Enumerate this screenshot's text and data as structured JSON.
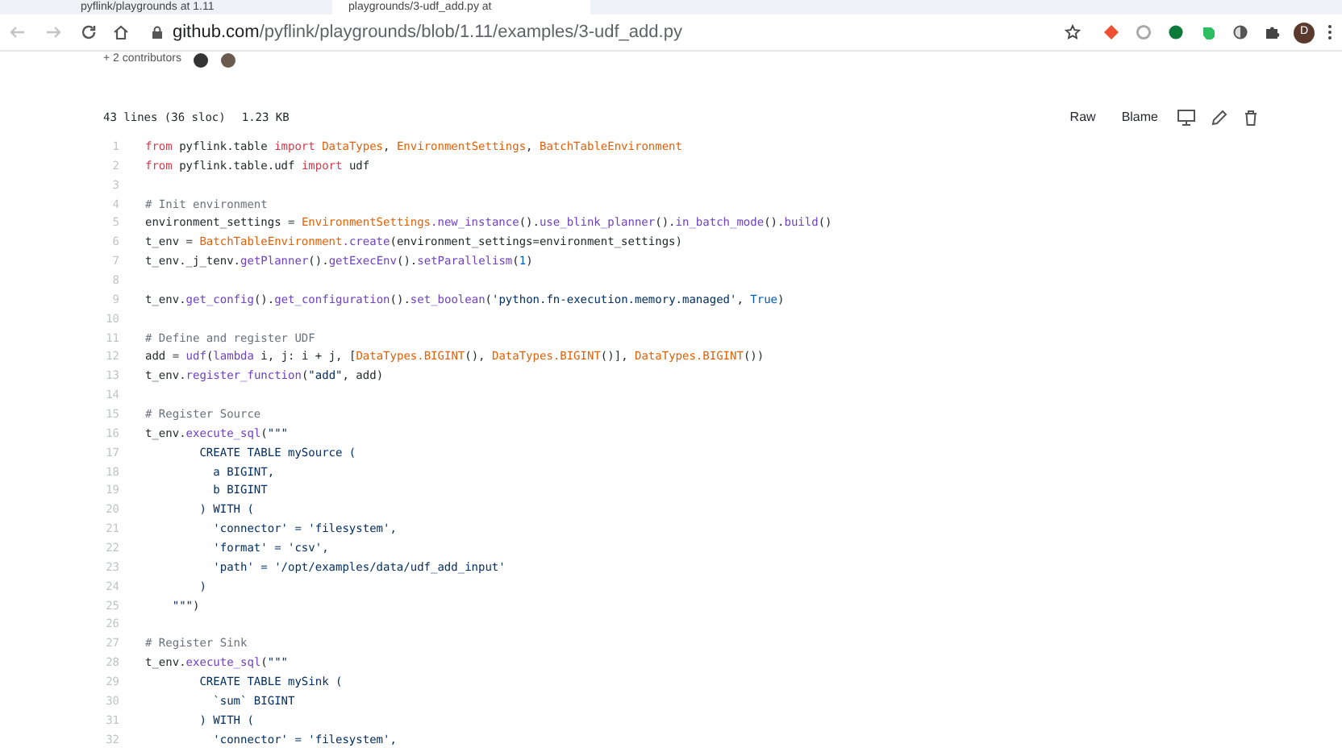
{
  "browser": {
    "tabs": [
      {
        "title": "pyflink/playgrounds at 1.11",
        "selected": false
      },
      {
        "title": "playgrounds/3-udf_add.py at",
        "selected": true
      }
    ],
    "url": {
      "host": "github.com",
      "path": "/pyflink/playgrounds/blob/1.11/examples/3-udf_add.py"
    },
    "avatar_letter": "D"
  },
  "contributors": "+ 2 contributors",
  "file": {
    "info": [
      "43 lines (36 sloc)",
      "1.23 KB"
    ],
    "actions": [
      "Raw",
      "Blame"
    ],
    "lines": [
      {
        "number": "1",
        "tokens": [
          {
            "kind": "kw",
            "text": "from"
          },
          {
            "kind": "plain",
            "text": " pyflink.table "
          },
          {
            "kind": "kw",
            "text": "import"
          },
          {
            "kind": "cls",
            "text": " DataTypes"
          },
          {
            "kind": "plain",
            "text": ", "
          },
          {
            "kind": "cls",
            "text": "EnvironmentSettings"
          },
          {
            "kind": "plain",
            "text": ", "
          },
          {
            "kind": "cls",
            "text": "BatchTableEnvironment"
          }
        ]
      },
      {
        "number": "2",
        "tokens": [
          {
            "kind": "kw",
            "text": "from"
          },
          {
            "kind": "plain",
            "text": " pyflink.table.udf "
          },
          {
            "kind": "kw",
            "text": "import"
          },
          {
            "kind": "plain",
            "text": " udf"
          }
        ]
      },
      {
        "number": "3"
      },
      {
        "number": "4",
        "tokens": [
          {
            "kind": "com",
            "text": "# Init environment"
          }
        ]
      },
      {
        "number": "5",
        "tokens": [
          {
            "kind": "plain",
            "text": "environment_settings = "
          },
          {
            "kind": "cls",
            "text": "EnvironmentSettings"
          },
          {
            "kind": "fn",
            "text": ".new_instance"
          },
          {
            "kind": "plain",
            "text": "()."
          },
          {
            "kind": "fn",
            "text": "use_blink_planner"
          },
          {
            "kind": "plain",
            "text": "()."
          },
          {
            "kind": "fn",
            "text": "in_batch_mode"
          },
          {
            "kind": "plain",
            "text": "()."
          },
          {
            "kind": "fn",
            "text": "build"
          },
          {
            "kind": "plain",
            "text": "()"
          }
        ]
      },
      {
        "number": "6",
        "tokens": [
          {
            "kind": "plain",
            "text": "t_env = "
          },
          {
            "kind": "cls",
            "text": "BatchTableEnvironment"
          },
          {
            "kind": "fn",
            "text": ".create"
          },
          {
            "kind": "plain",
            "text": "(environment_settings=environment_settings)"
          }
        ]
      },
      {
        "number": "7",
        "tokens": [
          {
            "kind": "plain",
            "text": "t_env._j_tenv."
          },
          {
            "kind": "fn",
            "text": "getPlanner"
          },
          {
            "kind": "plain",
            "text": "()."
          },
          {
            "kind": "fn",
            "text": "getExecEnv"
          },
          {
            "kind": "plain",
            "text": "()."
          },
          {
            "kind": "fn",
            "text": "setParallelism"
          },
          {
            "kind": "plain",
            "text": "("
          },
          {
            "kind": "const",
            "text": "1"
          },
          {
            "kind": "plain",
            "text": ")"
          }
        ]
      },
      {
        "number": "8"
      },
      {
        "number": "9",
        "tokens": [
          {
            "kind": "plain",
            "text": "t_env."
          },
          {
            "kind": "fn",
            "text": "get_config"
          },
          {
            "kind": "plain",
            "text": "()."
          },
          {
            "kind": "fn",
            "text": "get_configuration"
          },
          {
            "kind": "plain",
            "text": "()."
          },
          {
            "kind": "fn",
            "text": "set_boolean"
          },
          {
            "kind": "plain",
            "text": "("
          },
          {
            "kind": "str",
            "text": "'python.fn-execution.memory.managed'"
          },
          {
            "kind": "plain",
            "text": ", "
          },
          {
            "kind": "const",
            "text": "True"
          },
          {
            "kind": "plain",
            "text": ")"
          }
        ]
      },
      {
        "number": "10"
      },
      {
        "number": "11",
        "tokens": [
          {
            "kind": "com",
            "text": "# Define and register UDF"
          }
        ]
      },
      {
        "number": "12",
        "tokens": [
          {
            "kind": "plain",
            "text": "add = "
          },
          {
            "kind": "fn",
            "text": "udf"
          },
          {
            "kind": "plain",
            "text": "("
          },
          {
            "kind": "fn",
            "text": "lambda"
          },
          {
            "kind": "plain",
            "text": " i, j: i + j, ["
          },
          {
            "kind": "cls",
            "text": "DataTypes.BIGINT"
          },
          {
            "kind": "plain",
            "text": "(), "
          },
          {
            "kind": "cls",
            "text": "DataTypes.BIGINT"
          },
          {
            "kind": "plain",
            "text": "()], "
          },
          {
            "kind": "cls",
            "text": "DataTypes.BIGINT"
          },
          {
            "kind": "plain",
            "text": "())"
          }
        ]
      },
      {
        "number": "13",
        "tokens": [
          {
            "kind": "plain",
            "text": "t_env."
          },
          {
            "kind": "fn",
            "text": "register_function"
          },
          {
            "kind": "plain",
            "text": "("
          },
          {
            "kind": "str",
            "text": "\"add\""
          },
          {
            "kind": "plain",
            "text": ", add)"
          }
        ]
      },
      {
        "number": "14"
      },
      {
        "number": "15",
        "tokens": [
          {
            "kind": "com",
            "text": "# Register Source"
          }
        ]
      },
      {
        "number": "16",
        "tokens": [
          {
            "kind": "plain",
            "text": "t_env."
          },
          {
            "kind": "fn",
            "text": "execute_sql"
          },
          {
            "kind": "plain",
            "text": "("
          },
          {
            "kind": "str",
            "text": "\"\"\""
          }
        ]
      },
      {
        "number": "17",
        "tokens": [
          {
            "kind": "str",
            "text": "        CREATE TABLE mySource ("
          }
        ]
      },
      {
        "number": "18",
        "tokens": [
          {
            "kind": "str",
            "text": "          a BIGINT,"
          }
        ]
      },
      {
        "number": "19",
        "tokens": [
          {
            "kind": "str",
            "text": "          b BIGINT"
          }
        ]
      },
      {
        "number": "20",
        "tokens": [
          {
            "kind": "str",
            "text": "        ) WITH ("
          }
        ]
      },
      {
        "number": "21",
        "tokens": [
          {
            "kind": "str",
            "text": "          'connector' = 'filesystem',"
          }
        ]
      },
      {
        "number": "22",
        "tokens": [
          {
            "kind": "str",
            "text": "          'format' = 'csv',"
          }
        ]
      },
      {
        "number": "23",
        "tokens": [
          {
            "kind": "str",
            "text": "          'path' = '/opt/examples/data/udf_add_input'"
          }
        ]
      },
      {
        "number": "24",
        "tokens": [
          {
            "kind": "str",
            "text": "        )"
          }
        ]
      },
      {
        "number": "25",
        "tokens": [
          {
            "kind": "str",
            "text": "    \"\"\""
          },
          {
            "kind": "plain",
            "text": ")"
          }
        ]
      },
      {
        "number": "26"
      },
      {
        "number": "27",
        "tokens": [
          {
            "kind": "com",
            "text": "# Register Sink"
          }
        ]
      },
      {
        "number": "28",
        "tokens": [
          {
            "kind": "plain",
            "text": "t_env."
          },
          {
            "kind": "fn",
            "text": "execute_sql"
          },
          {
            "kind": "plain",
            "text": "("
          },
          {
            "kind": "str",
            "text": "\"\"\""
          }
        ]
      },
      {
        "number": "29",
        "tokens": [
          {
            "kind": "str",
            "text": "        CREATE TABLE mySink ("
          }
        ]
      },
      {
        "number": "30",
        "tokens": [
          {
            "kind": "str",
            "text": "          `sum` BIGINT"
          }
        ]
      },
      {
        "number": "31",
        "tokens": [
          {
            "kind": "str",
            "text": "        ) WITH ("
          }
        ]
      },
      {
        "number": "32",
        "tokens": [
          {
            "kind": "str",
            "text": "          'connector' = 'filesystem',"
          }
        ]
      }
    ]
  }
}
